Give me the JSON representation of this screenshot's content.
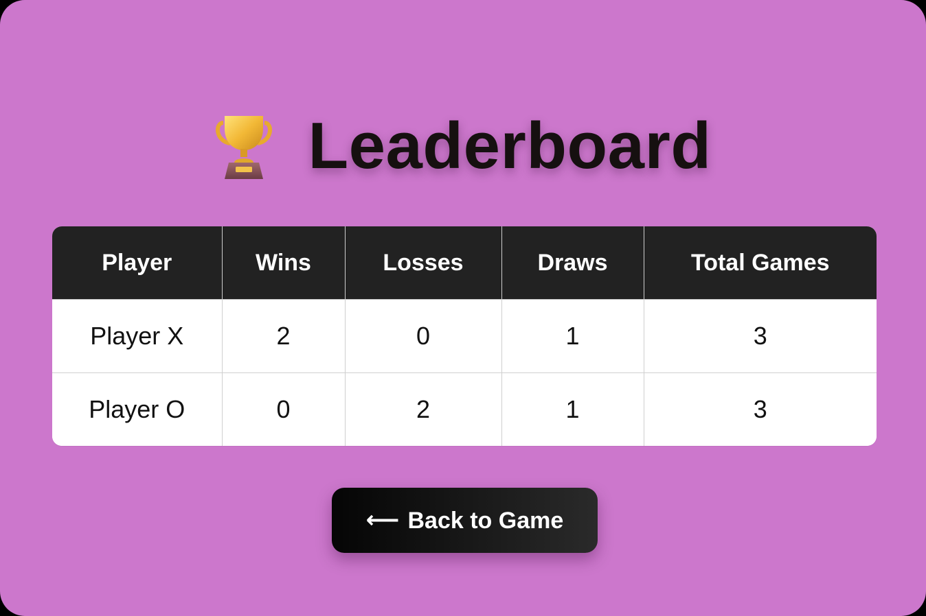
{
  "colors": {
    "background": "#cc77cc",
    "header_bg": "#222222",
    "title_text": "#161010",
    "button_bg": "#111111"
  },
  "header": {
    "icon": "trophy-icon",
    "title": "Leaderboard"
  },
  "leaderboard": {
    "columns": [
      "Player",
      "Wins",
      "Losses",
      "Draws",
      "Total Games"
    ],
    "rows": [
      [
        "Player X",
        "2",
        "0",
        "1",
        "3"
      ],
      [
        "Player O",
        "0",
        "2",
        "1",
        "3"
      ]
    ]
  },
  "back_button": {
    "icon": "arrow-left-icon",
    "arrow": "⟵",
    "label": "Back to Game"
  }
}
